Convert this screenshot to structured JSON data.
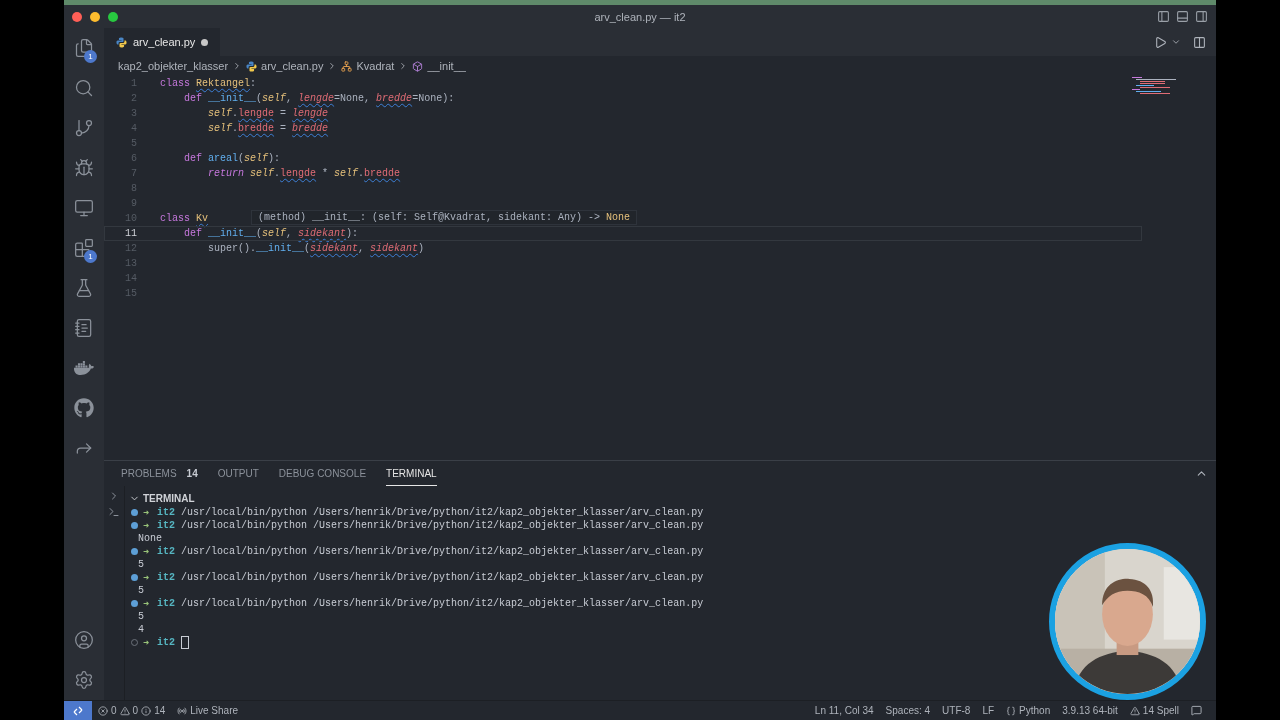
{
  "window": {
    "title": "arv_clean.py — it2"
  },
  "activity_bar": {
    "top": [
      {
        "kind": "files",
        "badge": "1"
      },
      {
        "kind": "search"
      },
      {
        "kind": "source-control"
      },
      {
        "kind": "run-debug"
      },
      {
        "kind": "remote"
      },
      {
        "kind": "extensions",
        "badge": "1"
      },
      {
        "kind": "testing"
      },
      {
        "kind": "notebook"
      },
      {
        "kind": "docker"
      },
      {
        "kind": "github"
      },
      {
        "kind": "live-share"
      }
    ],
    "bottom": [
      {
        "kind": "account"
      },
      {
        "kind": "settings"
      }
    ]
  },
  "editor_tabs": [
    {
      "label": "arv_clean.py",
      "modified": true,
      "selected": true
    }
  ],
  "breadcrumbs": [
    {
      "kind": "folder",
      "label": "kap2_objekter_klasser"
    },
    {
      "kind": "python-file",
      "label": "arv_clean.py"
    },
    {
      "kind": "class",
      "label": "Kvadrat"
    },
    {
      "kind": "method",
      "label": "__init__"
    }
  ],
  "code_lines": [
    {
      "number": "1",
      "current": false,
      "tokens": [
        {
          "text": "class ",
          "kind": "kw"
        },
        {
          "text": "Rektangel",
          "kind": "cls",
          "squiggle": true
        },
        {
          "text": ":",
          "kind": "plain"
        }
      ]
    },
    {
      "number": "2",
      "current": false,
      "tokens": [
        {
          "text": "    def ",
          "kind": "kw"
        },
        {
          "text": "__init__",
          "kind": "fn"
        },
        {
          "text": "(",
          "kind": "plain"
        },
        {
          "text": "self",
          "kind": "self"
        },
        {
          "text": ", ",
          "kind": "plain"
        },
        {
          "text": "lengde",
          "kind": "param",
          "squiggle": true
        },
        {
          "text": "=None, ",
          "kind": "plain"
        },
        {
          "text": "bredde",
          "kind": "param",
          "squiggle": true
        },
        {
          "text": "=None):",
          "kind": "plain"
        }
      ]
    },
    {
      "number": "3",
      "current": false,
      "tokens": [
        {
          "text": "        self",
          "kind": "self"
        },
        {
          "text": ".",
          "kind": "plain"
        },
        {
          "text": "lengde",
          "kind": "attr",
          "squiggle": true
        },
        {
          "text": " = ",
          "kind": "plain"
        },
        {
          "text": "lengde",
          "kind": "param",
          "squiggle": true
        }
      ]
    },
    {
      "number": "4",
      "current": false,
      "tokens": [
        {
          "text": "        self",
          "kind": "self"
        },
        {
          "text": ".",
          "kind": "plain"
        },
        {
          "text": "bredde",
          "kind": "attr",
          "squiggle": true
        },
        {
          "text": " = ",
          "kind": "plain"
        },
        {
          "text": "bredde",
          "kind": "param",
          "squiggle": true
        }
      ]
    },
    {
      "number": "5",
      "current": false
    },
    {
      "number": "6",
      "current": false,
      "tokens": [
        {
          "text": "    def ",
          "kind": "kw"
        },
        {
          "text": "areal",
          "kind": "fn"
        },
        {
          "text": "(",
          "kind": "plain"
        },
        {
          "text": "self",
          "kind": "self"
        },
        {
          "text": "):",
          "kind": "plain"
        }
      ]
    },
    {
      "number": "7",
      "current": false,
      "tokens": [
        {
          "text": "        return ",
          "kind": "kwi"
        },
        {
          "text": "self",
          "kind": "self"
        },
        {
          "text": ".",
          "kind": "plain"
        },
        {
          "text": "lengde",
          "kind": "attr",
          "squiggle": true
        },
        {
          "text": " * ",
          "kind": "plain"
        },
        {
          "text": "self",
          "kind": "self"
        },
        {
          "text": ".",
          "kind": "plain"
        },
        {
          "text": "bredde",
          "kind": "attr",
          "squiggle": true
        }
      ]
    },
    {
      "number": "8",
      "current": false
    },
    {
      "number": "9",
      "current": false
    },
    {
      "number": "10",
      "current": false,
      "tokens": [
        {
          "text": "class ",
          "kind": "kw"
        },
        {
          "text": "Kv",
          "kind": "cls",
          "squiggle": true
        }
      ],
      "hover": [
        {
          "text": "(method) __init__: (self: Self@Kvadrat, sidekant: Any) -> ",
          "kind": "plain"
        },
        {
          "text": "None",
          "kind": "cls"
        }
      ]
    },
    {
      "number": "11",
      "current": true,
      "tokens": [
        {
          "text": "    def ",
          "kind": "kw"
        },
        {
          "text": "__init__",
          "kind": "fn"
        },
        {
          "text": "(",
          "kind": "plain"
        },
        {
          "text": "self",
          "kind": "self"
        },
        {
          "text": ", ",
          "kind": "plain"
        },
        {
          "text": "sidekant",
          "kind": "param",
          "squiggle": true
        },
        {
          "text": "):",
          "kind": "plain"
        }
      ]
    },
    {
      "number": "12",
      "current": false,
      "tokens": [
        {
          "text": "        super().",
          "kind": "plain"
        },
        {
          "text": "__init__",
          "kind": "fn"
        },
        {
          "text": "(",
          "kind": "plain"
        },
        {
          "text": "sidekant",
          "kind": "param",
          "squiggle": true
        },
        {
          "text": ", ",
          "kind": "plain"
        },
        {
          "text": "sidekant",
          "kind": "param",
          "squiggle": true
        },
        {
          "text": ")",
          "kind": "plain"
        }
      ]
    },
    {
      "number": "13",
      "current": false
    },
    {
      "number": "14",
      "current": false
    },
    {
      "number": "15",
      "current": false
    }
  ],
  "panel": {
    "tabs": [
      {
        "label": "PROBLEMS",
        "count": "14",
        "selected": false
      },
      {
        "label": "OUTPUT",
        "selected": false
      },
      {
        "label": "DEBUG CONSOLE",
        "selected": false
      },
      {
        "label": "TERMINAL",
        "selected": true
      }
    ],
    "section": {
      "label": "TERMINAL",
      "expanded": true
    },
    "lines": [
      {
        "kind": "command",
        "finished": true,
        "arrow": "➜",
        "dir": "it2",
        "text": "/usr/local/bin/python /Users/henrik/Drive/python/it2/kap2_objekter_klasser/arv_clean.py"
      },
      {
        "kind": "command",
        "finished": true,
        "arrow": "➜",
        "dir": "it2",
        "text": "/usr/local/bin/python /Users/henrik/Drive/python/it2/kap2_objekter_klasser/arv_clean.py"
      },
      {
        "kind": "output",
        "text": "None"
      },
      {
        "kind": "command",
        "finished": true,
        "arrow": "➜",
        "dir": "it2",
        "text": "/usr/local/bin/python /Users/henrik/Drive/python/it2/kap2_objekter_klasser/arv_clean.py"
      },
      {
        "kind": "output",
        "text": "5"
      },
      {
        "kind": "command",
        "finished": true,
        "arrow": "➜",
        "dir": "it2",
        "text": "/usr/local/bin/python /Users/henrik/Drive/python/it2/kap2_objekter_klasser/arv_clean.py"
      },
      {
        "kind": "output",
        "text": "5"
      },
      {
        "kind": "command",
        "finished": true,
        "arrow": "➜",
        "dir": "it2",
        "text": "/usr/local/bin/python /Users/henrik/Drive/python/it2/kap2_objekter_klasser/arv_clean.py"
      },
      {
        "kind": "output",
        "text": "5"
      },
      {
        "kind": "output",
        "text": "4"
      },
      {
        "kind": "prompt",
        "finished": false,
        "arrow": "➜",
        "dir": "it2",
        "cursor": true
      }
    ]
  },
  "status_bar": {
    "left": [
      {
        "kind": "remote"
      },
      {
        "kind": "problems",
        "errors": "0",
        "warnings": "0",
        "infos": "14"
      },
      {
        "kind": "live-share",
        "text": "Live Share"
      }
    ],
    "right": [
      {
        "kind": "text",
        "text": "Ln 11, Col 34"
      },
      {
        "kind": "text",
        "text": "Spaces: 4"
      },
      {
        "kind": "text",
        "text": "UTF-8"
      },
      {
        "kind": "text",
        "text": "LF"
      },
      {
        "kind": "language",
        "text": "Python"
      },
      {
        "kind": "text",
        "text": "3.9.13 64-bit"
      },
      {
        "kind": "spell",
        "text": "14 Spell"
      },
      {
        "kind": "feedback"
      }
    ]
  }
}
